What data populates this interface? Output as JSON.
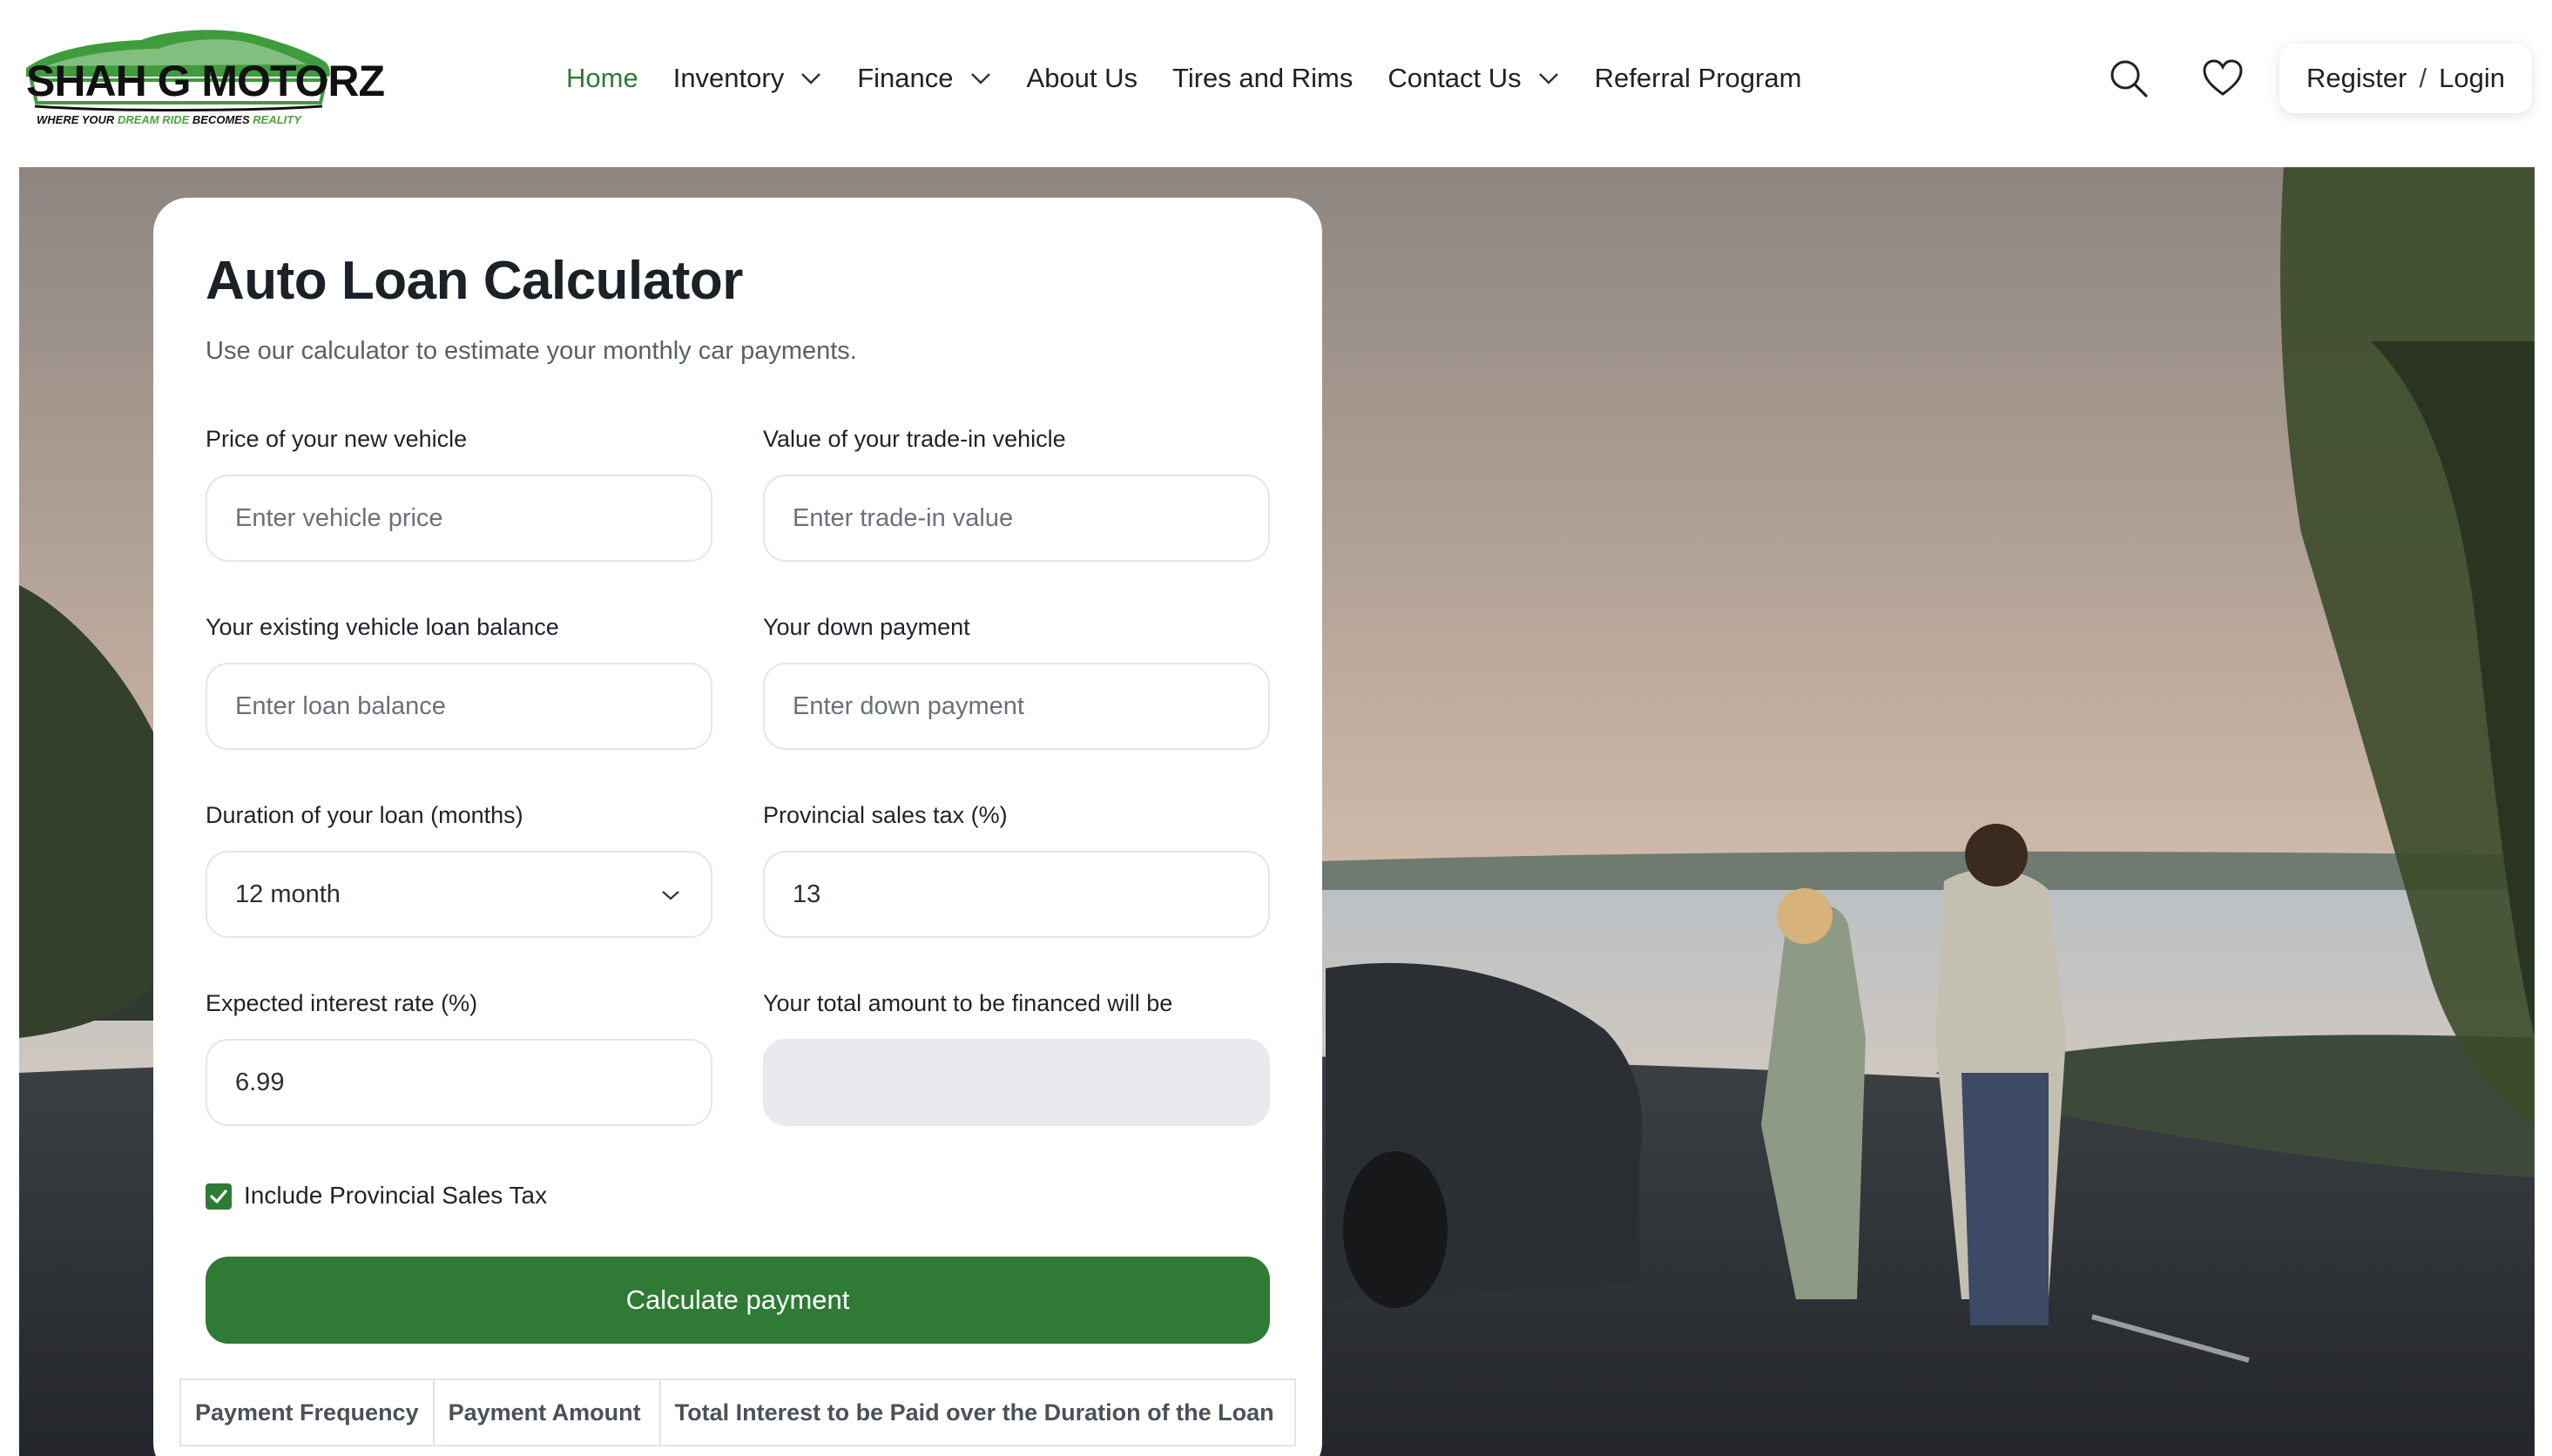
{
  "brand": {
    "name": "SHAH G MOTORZ",
    "tagline_pre": "WHERE YOUR",
    "tagline_green": "DREAM RIDE",
    "tagline_mid": "BECOMES",
    "tagline_end": "REALITY",
    "accent_color": "#2f7a34"
  },
  "nav": {
    "items": [
      {
        "label": "Home",
        "active": true
      },
      {
        "label": "Inventory",
        "dropdown": true
      },
      {
        "label": "Finance",
        "dropdown": true
      },
      {
        "label": "About Us"
      },
      {
        "label": "Tires and Rims"
      },
      {
        "label": "Contact Us",
        "dropdown": true
      },
      {
        "label": "Referral Program"
      }
    ],
    "icons": [
      "search-icon",
      "heart-icon"
    ],
    "register_label": "Register",
    "separator": "/",
    "login_label": "Login"
  },
  "calculator": {
    "title": "Auto Loan Calculator",
    "subtitle": "Use our calculator to estimate your monthly car payments.",
    "fields": {
      "price": {
        "label": "Price of your new vehicle",
        "placeholder": "Enter vehicle price"
      },
      "trade_in": {
        "label": "Value of your trade-in vehicle",
        "placeholder": "Enter trade-in value"
      },
      "loan_balance": {
        "label": "Your existing vehicle loan balance",
        "placeholder": "Enter loan balance"
      },
      "down_payment": {
        "label": "Your down payment",
        "placeholder": "Enter down payment"
      },
      "duration": {
        "label": "Duration of your loan (months)",
        "value": "12 month"
      },
      "tax": {
        "label": "Provincial sales tax (%)",
        "value": "13"
      },
      "interest": {
        "label": "Expected interest rate (%)",
        "value": "6.99"
      },
      "financed": {
        "label": "Your total amount to be financed will be",
        "value": ""
      }
    },
    "include_tax": {
      "label": "Include Provincial Sales Tax",
      "checked": true
    },
    "calculate_label": "Calculate payment",
    "results_headers": [
      "Payment Frequency",
      "Payment Amount",
      "Total Interest to be Paid over the Duration of the Loan"
    ]
  }
}
